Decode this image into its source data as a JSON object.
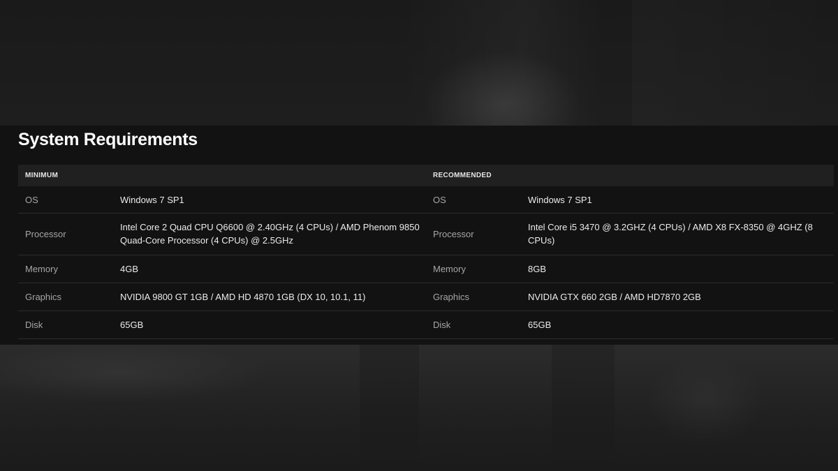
{
  "section": {
    "title": "System Requirements"
  },
  "table": {
    "headers": [
      "MINIMUM",
      "RECOMMENDED"
    ],
    "rows": [
      {
        "min_label": "OS",
        "min_value": "Windows 7 SP1",
        "rec_label": "OS",
        "rec_value": "Windows 7 SP1"
      },
      {
        "min_label": "Processor",
        "min_value": "Intel Core 2 Quad CPU Q6600 @ 2.40GHz (4 CPUs) / AMD Phenom 9850 Quad-Core Processor (4 CPUs) @ 2.5GHz",
        "rec_label": "Processor",
        "rec_value": "Intel Core i5 3470 @ 3.2GHZ (4 CPUs) / AMD X8 FX-8350 @ 4GHZ (8 CPUs)"
      },
      {
        "min_label": "Memory",
        "min_value": "4GB",
        "rec_label": "Memory",
        "rec_value": "8GB"
      },
      {
        "min_label": "Graphics",
        "min_value": "NVIDIA 9800 GT 1GB / AMD HD 4870 1GB (DX 10, 10.1, 11)",
        "rec_label": "Graphics",
        "rec_value": "NVIDIA GTX 660 2GB / AMD HD7870 2GB"
      },
      {
        "min_label": "Disk",
        "min_value": "65GB",
        "rec_label": "Disk",
        "rec_value": "65GB"
      }
    ]
  }
}
